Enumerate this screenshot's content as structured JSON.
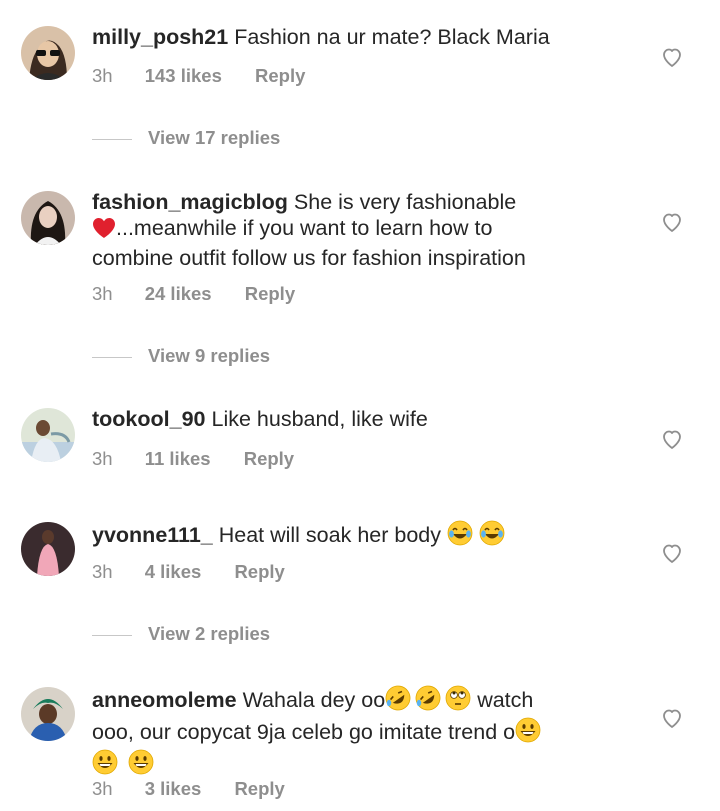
{
  "comments": [
    {
      "username": "milly_posh21",
      "text": "Fashion na ur mate? Black Maria",
      "time": "3h",
      "likes": "143 likes",
      "reply": "Reply",
      "view_replies": "View 17 replies"
    },
    {
      "username": "fashion_magicblog",
      "text_line1": "She is very fashionable",
      "text_line2": "...meanwhile if you want to learn how to",
      "text_line3": "combine outfit follow us for fashion inspiration",
      "time": "3h",
      "likes": "24 likes",
      "reply": "Reply",
      "view_replies": "View 9 replies"
    },
    {
      "username": "tookool_90",
      "text": "Like husband, like wife",
      "time": "3h",
      "likes": "11 likes",
      "reply": "Reply"
    },
    {
      "username": "yvonne111_",
      "text": "Heat will soak her body",
      "time": "3h",
      "likes": "4 likes",
      "reply": "Reply",
      "view_replies": "View 2 replies"
    },
    {
      "username": "anneomoleme",
      "text_a": "Wahala dey oo",
      "text_b": "watch",
      "text_c": "ooo, our copycat 9ja celeb go imitate trend o",
      "time": "3h",
      "likes": "3 likes",
      "reply": "Reply"
    }
  ],
  "icons": {
    "heart": "heart-outline-icon",
    "laugh_cry": "face-with-tears-of-joy-emoji",
    "rofl": "rolling-on-floor-laughing-emoji",
    "eye_roll": "face-with-rolling-eyes-emoji",
    "grin": "grinning-face-emoji",
    "red_heart": "red-heart-emoji"
  },
  "colors": {
    "text": "#262626",
    "secondary": "#8e8e8e",
    "divider": "#c7c7c7",
    "emoji_yellow": "#ffcc33",
    "heart_red": "#e0202e"
  }
}
